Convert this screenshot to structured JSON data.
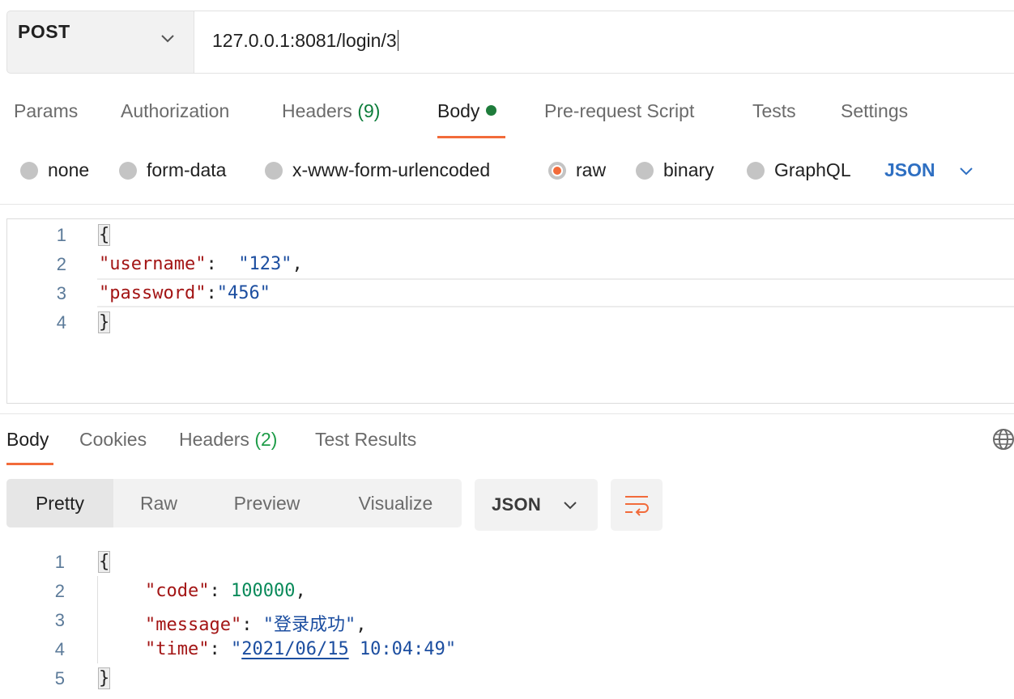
{
  "request": {
    "method": "POST",
    "url": "127.0.0.1:8081/login/3"
  },
  "request_tabs": {
    "params": "Params",
    "authorization": "Authorization",
    "headers": "Headers",
    "headers_count": "(9)",
    "body": "Body",
    "pre_request": "Pre-request Script",
    "tests": "Tests",
    "settings": "Settings"
  },
  "body_types": {
    "none": "none",
    "form_data": "form-data",
    "urlencoded": "x-www-form-urlencoded",
    "raw": "raw",
    "binary": "binary",
    "graphql": "GraphQL",
    "selected": "raw",
    "language": "JSON"
  },
  "request_body": {
    "line_numbers": [
      "1",
      "2",
      "3",
      "4"
    ],
    "open_brace": "{",
    "username_key": "\"username\"",
    "username_value": "\"123\"",
    "password_key": "\"password\"",
    "password_value": "\"456\"",
    "close_brace": "}"
  },
  "response_tabs": {
    "body": "Body",
    "cookies": "Cookies",
    "headers": "Headers",
    "headers_count": "(2)",
    "test_results": "Test Results"
  },
  "response_view": {
    "pretty": "Pretty",
    "raw": "Raw",
    "preview": "Preview",
    "visualize": "Visualize",
    "format": "JSON"
  },
  "response_body": {
    "line_numbers": [
      "1",
      "2",
      "3",
      "4",
      "5"
    ],
    "open_brace": "{",
    "code_key": "\"code\"",
    "code_value": "100000",
    "message_key": "\"message\"",
    "message_value": "\"登录成功\"",
    "time_key": "\"time\"",
    "time_quote_open": "\"",
    "time_date": "2021/06/15",
    "time_clock": "10:04:49",
    "time_quote_close": "\"",
    "close_brace": "}"
  },
  "colors": {
    "accent": "#f26b3a",
    "json_key": "#a31515",
    "json_string": "#1c4ea0",
    "json_number": "#0a8a5a",
    "language_link": "#2e6fc2"
  },
  "icons": [
    "chevron-down-icon",
    "globe-icon",
    "wrap-lines-icon"
  ]
}
